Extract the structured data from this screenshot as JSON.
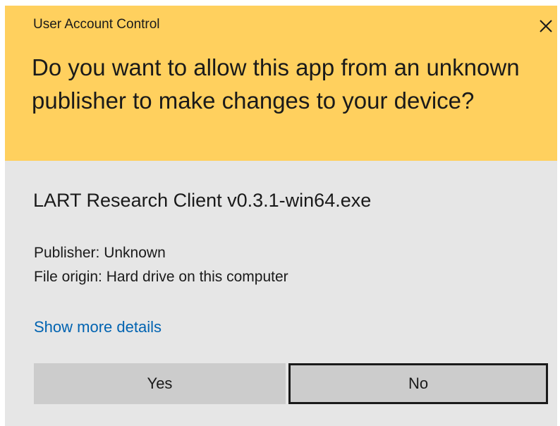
{
  "dialog": {
    "title": "User Account Control",
    "question": "Do you want to allow this app from an unknown publisher to make changes to your device?",
    "header_color": "#ffd05e",
    "body_color": "#e6e6e6"
  },
  "app": {
    "name": "LART Research Client v0.3.1-win64.exe",
    "publisher": "Publisher: Unknown",
    "origin": "File origin: Hard drive on this computer"
  },
  "details_link": {
    "label": "Show more details",
    "color": "#0063b1"
  },
  "buttons": {
    "yes_label": "Yes",
    "no_label": "No",
    "focused": "No"
  },
  "icons": {
    "close": "close-icon"
  }
}
